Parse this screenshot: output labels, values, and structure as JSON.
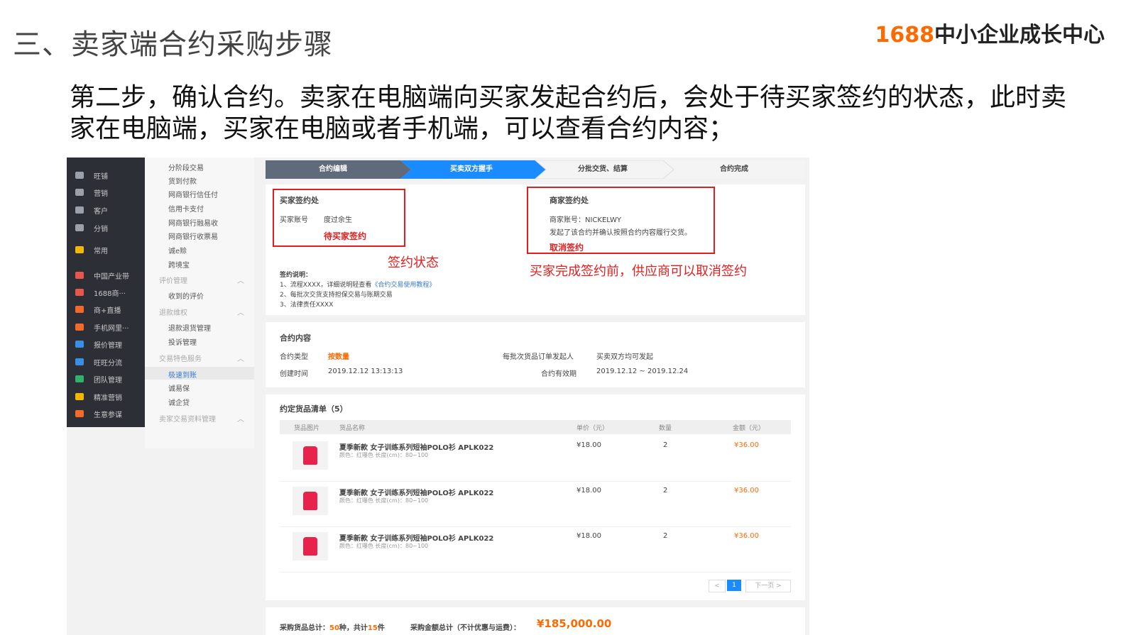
{
  "slide": {
    "title": "三、卖家端合约采购步骤",
    "brand_number": "1688",
    "brand_text": "中小企业成长中心",
    "description": "第二步，确认合约。卖家在电脑端向买家发起合约后，会处于待买家签约的状态，此时卖家在电脑端，买家在电脑或者手机端，可以查看合约内容；"
  },
  "nav": {
    "items": [
      {
        "label": "旺铺",
        "icon": "shop-icon",
        "color": "#9aa0aa"
      },
      {
        "label": "营销",
        "icon": "tag-icon",
        "color": "#9aa0aa"
      },
      {
        "label": "客户",
        "icon": "user-icon",
        "color": "#9aa0aa"
      },
      {
        "label": "分销",
        "icon": "share-icon",
        "color": "#9aa0aa"
      },
      {
        "label": "常用",
        "icon": "star-icon",
        "color": "#f5b800"
      },
      {
        "label": "中国产业带",
        "icon": "map-pin-icon",
        "color": "#e8544e"
      },
      {
        "label": "1688商···",
        "icon": "store-icon",
        "color": "#e8544e"
      },
      {
        "label": "商+直播",
        "icon": "live-icon",
        "color": "#f06a2a"
      },
      {
        "label": "手机网里···",
        "icon": "phone-icon",
        "color": "#f06a2a"
      },
      {
        "label": "报价管理",
        "icon": "quote-icon",
        "color": "#3a8ee6"
      },
      {
        "label": "旺旺分流",
        "icon": "chat-icon",
        "color": "#3a8ee6"
      },
      {
        "label": "团队管理",
        "icon": "team-icon",
        "color": "#2fb36c"
      },
      {
        "label": "精准营销",
        "icon": "target-icon",
        "color": "#f5b800"
      },
      {
        "label": "生意参谋",
        "icon": "chart-icon",
        "color": "#f06a2a"
      }
    ]
  },
  "submenu": {
    "items": [
      "分阶段交易",
      "货到付款",
      "网商银行信任付",
      "信用卡支付",
      "网商银行融易收",
      "网商银行收票易",
      "诚e赊",
      "跨境宝"
    ],
    "group_review": "评价管理",
    "review_items": [
      "收到的评价"
    ],
    "group_refund": "退款维权",
    "refund_items": [
      "退款退货管理",
      "投诉管理"
    ],
    "group_trade": "交易特色服务",
    "trade_items": [
      "极速到账",
      "诚易保",
      "诚企贷"
    ],
    "group_data": "卖家交易资料管理"
  },
  "steps": [
    "合约编辑",
    "买卖双方握手",
    "分批交货、结算",
    "合约完成"
  ],
  "buyer": {
    "title": "买家签约处",
    "account_label": "买家账号",
    "account_value": "度过余生",
    "status": "待买家签约"
  },
  "seller": {
    "title": "商家签约处",
    "account_line": "商家账号：NICKELWY",
    "note": "发起了该合约并确认按照合约内容履行交货。",
    "cancel": "取消签约"
  },
  "annotations": {
    "sign_status": "签约状态",
    "cancel_note": "买家完成签约前，供应商可以取消签约"
  },
  "explain": {
    "title": "签约说明：",
    "line1": "1、流程XXXX，详细说明轻查看",
    "line1_link": "《合约交易使用教程》",
    "line2": "2、每批次交货支持担保交易与账期交易",
    "line3": "3、法律责任XXXX"
  },
  "contract": {
    "title": "合约内容",
    "type_label": "合约类型",
    "type_value": "按数量",
    "order_label": "每批次货品订单发起人",
    "order_value": "买卖双方均可发起",
    "created_label": "创建时间",
    "created_value": "2019.12.12 13:13:13",
    "period_label": "合约有效期",
    "period_value": "2019.12.12 ~ 2019.12.24"
  },
  "goods": {
    "title": "约定货品清单（5）",
    "headers": [
      "货品图片",
      "货品名称",
      "单价（元）",
      "数量",
      "金额（元）"
    ],
    "rows": [
      {
        "name": "夏季新款 女子训练系列短袖POLO衫 APLK022",
        "spec": "颜色：红曝色    长度(cm)：80~100",
        "price": "¥18.00",
        "qty": "2",
        "amount": "¥36.00"
      },
      {
        "name": "夏季新款 女子训练系列短袖POLO衫 APLK022",
        "spec": "颜色：红曝色    长度(cm)：80~100",
        "price": "¥18.00",
        "qty": "2",
        "amount": "¥36.00"
      },
      {
        "name": "夏季新款 女子训练系列短袖POLO衫 APLK022",
        "spec": "颜色：红曝色    长度(cm)：80~100",
        "price": "¥18.00",
        "qty": "2",
        "amount": "¥36.00"
      }
    ],
    "page_prev": "<",
    "page_current": "1",
    "page_next": "下一页 >"
  },
  "summary": {
    "goods_total_label": "采购货品总计：",
    "kinds": "50",
    "kinds_unit": "种，共计",
    "pieces": "15",
    "pieces_unit": "件",
    "amount_label": "采购金额总计（不计优惠与运费）：",
    "amount": "¥185,000.00"
  }
}
